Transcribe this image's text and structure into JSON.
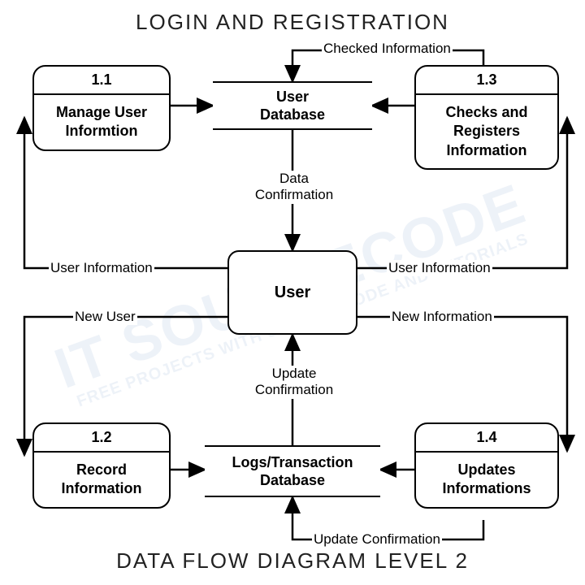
{
  "titles": {
    "top": "LOGIN AND REGISTRATION",
    "bottom": "DATA FLOW DIAGRAM LEVEL 2"
  },
  "entity": {
    "user": "User"
  },
  "datastores": {
    "userDb": "User\nDatabase",
    "logsDb": "Logs/Transaction\nDatabase"
  },
  "processes": {
    "p11": {
      "id": "1.1",
      "label": "Manage User\nInformtion"
    },
    "p12": {
      "id": "1.2",
      "label": "Record\nInformation"
    },
    "p13": {
      "id": "1.3",
      "label": "Checks and\nRegisters\nInformation"
    },
    "p14": {
      "id": "1.4",
      "label": "Updates\nInformations"
    }
  },
  "flows": {
    "checkedInfo": "Checked Information",
    "dataConfirm": "Data\nConfirmation",
    "userInfoLeft": "User Information",
    "userInfoRight": "User Information",
    "newUser": "New User",
    "newInfo": "New Information",
    "updateConfirmMid": "Update\nConfirmation",
    "updateConfirmBottom": "Update Confirmation"
  },
  "watermark": {
    "main": "IT SOURCECODE",
    "sub": "FREE PROJECTS WITH SOURCE CODE AND TUTORIALS"
  }
}
